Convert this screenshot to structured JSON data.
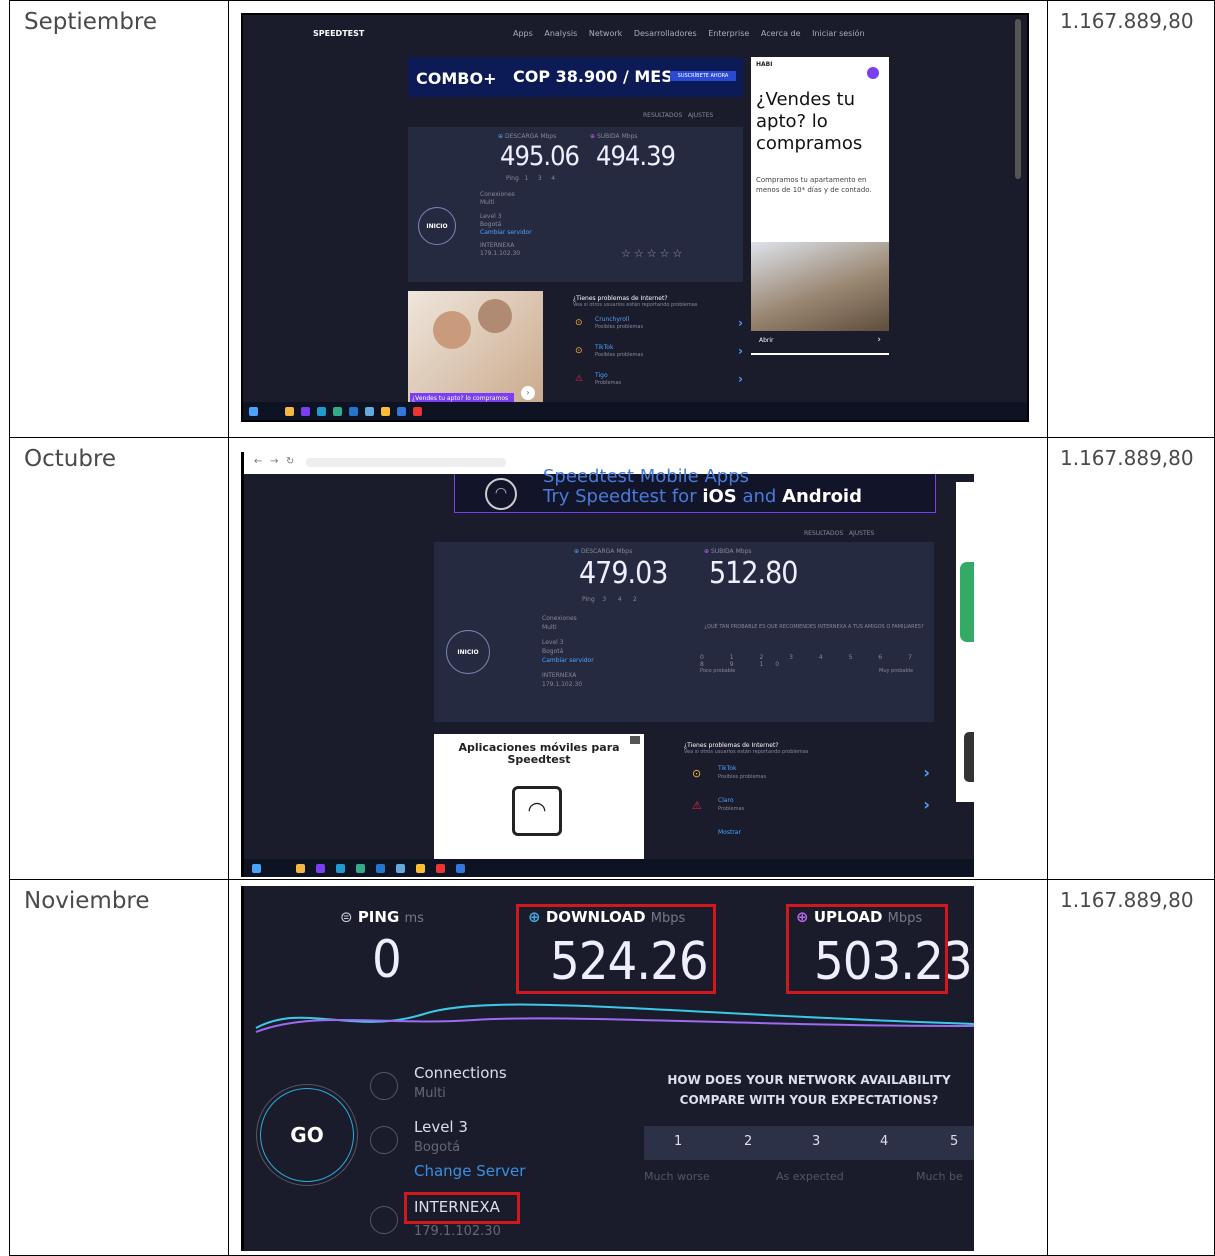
{
  "rows": [
    {
      "month": "Septiembre",
      "cost": "1.167.889,80",
      "shot": {
        "brand": "SPEEDTEST",
        "nav": [
          "Apps",
          "Analysis",
          "Network",
          "Desarrolladores",
          "Enterprise",
          "Acerca de",
          "Iniciar sesión"
        ],
        "ad_top_left": "COMBO+",
        "ad_top_price": "COP 38.900 / MES",
        "ad_top_button": "SUSCRÍBETE AHORA",
        "download_label": "DESCARGA",
        "upload_label": "SUBIDA",
        "unit": "Mbps",
        "download": "495.06",
        "upload": "494.39",
        "ping_label": "Ping",
        "ping_values": [
          "1",
          "3",
          "4"
        ],
        "go": "INICIO",
        "conn_title": "Conexiones",
        "conn_sub": "Multi",
        "server": "Level 3",
        "server_city": "Bogotá",
        "change_server": "Cambiar servidor",
        "isp": "INTERNEXA",
        "isp_ip": "179.1.102.30",
        "results_label": "RESULTADOS",
        "settings_label": "AJUSTES",
        "side_ad_brand": "HABI",
        "side_ad_title": "¿Vendes tu apto? lo compramos",
        "side_ad_body": "Compramos tu apartamento en menos de 10* días y de contado.",
        "side_ad_button": "Abrir",
        "bottom_ad_caption": "¿Vendes tu apto? lo compramos",
        "problems_title": "¿Tienes problemas de Internet?",
        "problems_sub": "Vea si otros usuarios están reportando problemas",
        "problems": [
          {
            "name": "Crunchyroll",
            "sub": "Posibles problemas"
          },
          {
            "name": "TikTok",
            "sub": "Posibles problemas"
          },
          {
            "name": "Tigo",
            "sub": "Problemas"
          }
        ]
      }
    },
    {
      "month": "Octubre",
      "cost": "1.167.889,80",
      "shot": {
        "banner_title": "Speedtest Mobile Apps",
        "banner_sub_prefix": "Try Speedtest for ",
        "banner_ios": "iOS",
        "banner_and": " and ",
        "banner_android": "Android",
        "download_label": "DESCARGA",
        "upload_label": "SUBIDA",
        "unit": "Mbps",
        "download": "479.03",
        "upload": "512.80",
        "ping_label": "Ping",
        "ping_values": [
          "3",
          "4",
          "2"
        ],
        "go": "INICIO",
        "conn_title": "Conexiones",
        "conn_sub": "Multi",
        "server": "Level 3",
        "server_city": "Bogotá",
        "change_server": "Cambiar servidor",
        "isp": "INTERNEXA",
        "isp_ip": "179.1.102.30",
        "nps_question": "¿QUÉ TAN PROBABLE ES QUE RECOMIENDES INTERNEXA A TUS AMIGOS O FAMILIARES?",
        "nps_scale": [
          "0",
          "1",
          "2",
          "3",
          "4",
          "5",
          "6",
          "7",
          "8",
          "9",
          "10"
        ],
        "nps_low": "Poco probable",
        "nps_high": "Muy probable",
        "results_label": "RESULTADOS",
        "settings_label": "AJUSTES",
        "apps_title": "Aplicaciones móviles para Speedtest",
        "problems_title": "¿Tienes problemas de Internet?",
        "problems_sub": "Vea si otros usuarios están reportando problemas",
        "problems": [
          {
            "name": "TikTok",
            "sub": "Posibles problemas"
          },
          {
            "name": "Claro",
            "sub": "Problemas"
          },
          {
            "name": "Mostrar",
            "sub": ""
          }
        ]
      }
    },
    {
      "month": "Noviembre",
      "cost": "1.167.889,80",
      "shot": {
        "ping_label": "PING",
        "ping_unit": "ms",
        "ping": "0",
        "download_label": "DOWNLOAD",
        "upload_label": "UPLOAD",
        "unit": "Mbps",
        "download": "524.26",
        "upload": "503.23",
        "go": "GO",
        "conn_title": "Connections",
        "conn_sub": "Multi",
        "server": "Level 3",
        "server_city": "Bogotá",
        "change_server": "Change Server",
        "isp": "INTERNEXA",
        "isp_ip": "179.1.102.30",
        "question": "HOW DOES YOUR NETWORK AVAILABILITY COMPARE WITH YOUR EXPECTATIONS?",
        "scale": [
          "1",
          "2",
          "3",
          "4",
          "5"
        ],
        "scale_labels": [
          "Much worse",
          "As expected",
          "Much be"
        ]
      }
    }
  ],
  "colors": {
    "highlight": "#d0181e",
    "accent": "#4aa3ff",
    "panel": "#1c1e2e"
  }
}
